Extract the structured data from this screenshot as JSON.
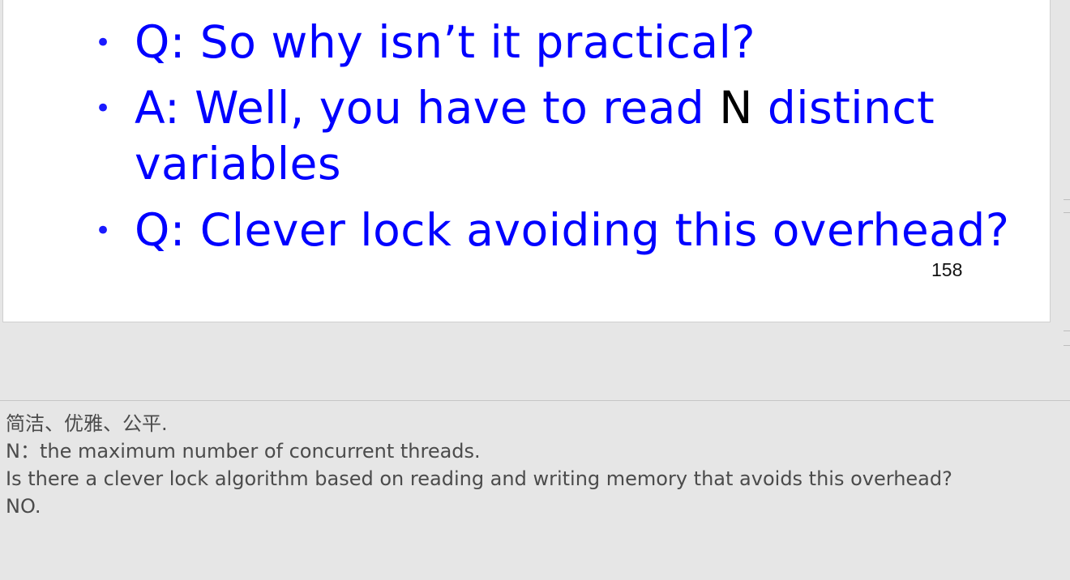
{
  "slide": {
    "bullets": [
      {
        "text": "Q: So why isn’t it practical?"
      },
      {
        "prefix": "A: Well, you have to read ",
        "var": "N",
        "suffix": " distinct",
        "line2": "variables"
      },
      {
        "text": "Q: Clever lock avoiding this overhead?"
      }
    ],
    "bullet_symbol": "•",
    "page_number": "158"
  },
  "notes": {
    "lines": [
      "简洁、优雅、公平.",
      "N：the maximum number of concurrent threads.",
      "Is there a clever lock algorithm based on reading and writing memory that avoids this overhead?",
      "NO."
    ]
  },
  "colors": {
    "bullet_text": "#0000ff",
    "variable_text": "#000000",
    "notes_text": "#4b4b4b",
    "background": "#e6e6e6"
  }
}
